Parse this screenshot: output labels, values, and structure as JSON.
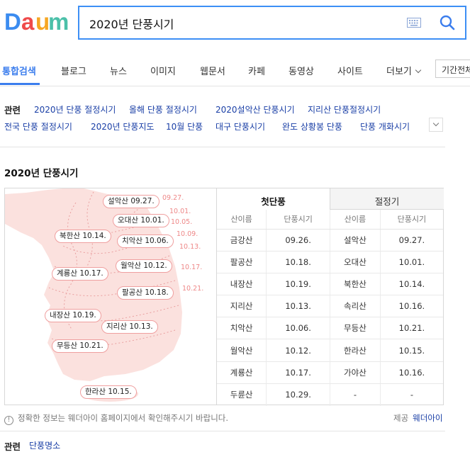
{
  "brand": {
    "logo_letters": [
      "D",
      "a",
      "u",
      "m"
    ],
    "logo_colors": [
      "#3b8cf0",
      "#ef4a4a",
      "#f6a623",
      "#4bc0a9"
    ]
  },
  "search": {
    "value": "2020년 단풍시기",
    "keyboard_icon": "keyboard-icon",
    "search_icon": "search-icon"
  },
  "tabs": [
    {
      "label": "통합검색",
      "active": true
    },
    {
      "label": "블로그"
    },
    {
      "label": "뉴스"
    },
    {
      "label": "이미지"
    },
    {
      "label": "웹문서"
    },
    {
      "label": "카페"
    },
    {
      "label": "동영상"
    },
    {
      "label": "사이트"
    },
    {
      "label": "더보기"
    }
  ],
  "period_button": "기간전체",
  "related": {
    "label": "관련",
    "links": [
      "2020년 단풍 절정시기",
      "올해 단풍 절정시기",
      "2020설악산 단풍시기",
      "지리산 단풍절정시기",
      "전국 단풍 절정시기",
      "2020년 단풍지도",
      "10월 단풍",
      "대구 단풍시기",
      "완도 상황봉 단풍",
      "단풍 개화시기"
    ]
  },
  "section_title": "2020년 단풍시기",
  "map": {
    "pills": [
      "설악산 09.27.",
      "오대산 10.01.",
      "북한산 10.14.",
      "치악산 10.06.",
      "계룡산 10.17.",
      "월악산 10.12.",
      "팔공산 10.18.",
      "내장산 10.19.",
      "지리산 10.13.",
      "무등산 10.21.",
      "한라산 10.15."
    ],
    "date_marks": [
      "09.27.",
      "10.01.",
      "10.05.",
      "10.09.",
      "10.13.",
      "10.17.",
      "10.21."
    ],
    "land_color": "#fbe1de",
    "line_color": "#e9a0a0"
  },
  "table": {
    "tab_first": "첫단풍",
    "tab_peak": "절정기",
    "headers": [
      "산이름",
      "단풍시기",
      "산이름",
      "단풍시기"
    ],
    "rows": [
      [
        "금강산",
        "09.26.",
        "설악산",
        "09.27."
      ],
      [
        "팔공산",
        "10.18.",
        "오대산",
        "10.01."
      ],
      [
        "내장산",
        "10.19.",
        "북한산",
        "10.14."
      ],
      [
        "지리산",
        "10.13.",
        "속리산",
        "10.16."
      ],
      [
        "치악산",
        "10.06.",
        "무등산",
        "10.21."
      ],
      [
        "월악산",
        "10.12.",
        "한라산",
        "10.15."
      ],
      [
        "계룡산",
        "10.17.",
        "가야산",
        "10.16."
      ],
      [
        "두륜산",
        "10.29.",
        "-",
        "-"
      ]
    ]
  },
  "note": {
    "icon": "!",
    "text": "정확한 정보는 웨더아이 홈페이지에서 확인해주시기 바랍니다."
  },
  "provider": {
    "label": "제공",
    "name": "웨더아이"
  },
  "bottom_related": {
    "label": "관련",
    "link": "단풍명소"
  }
}
